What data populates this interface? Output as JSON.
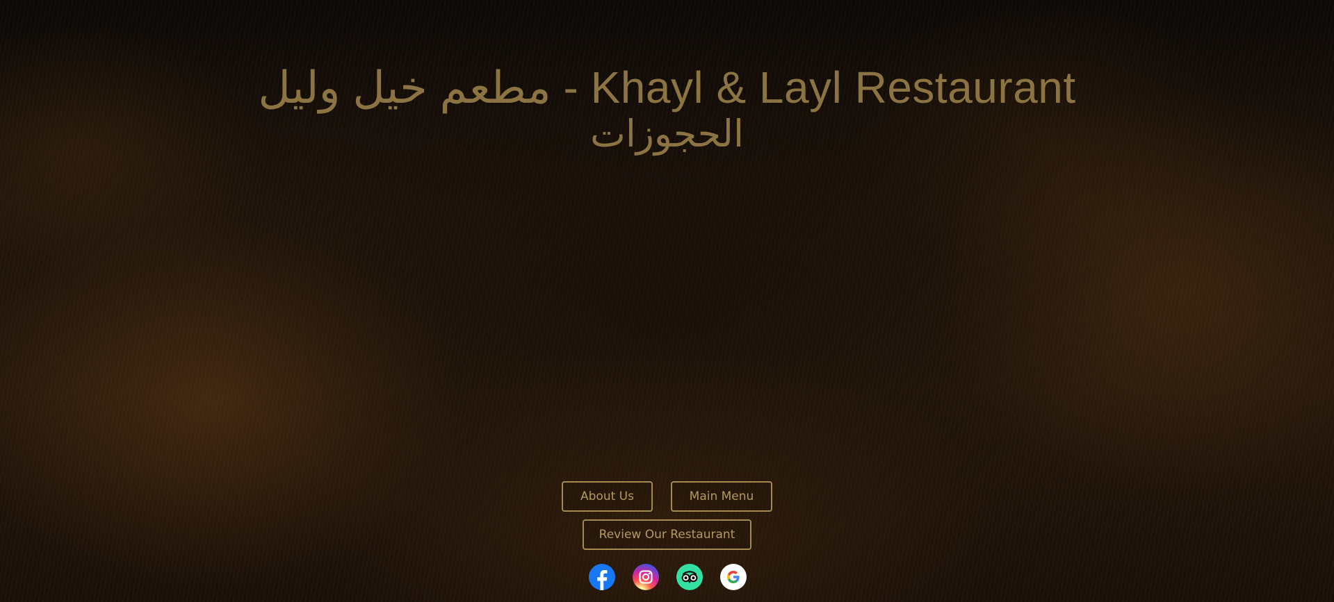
{
  "header": {
    "title": "مطعم خيل وليل - Khayl & Layl Restaurant",
    "subtitle": "الحجوزات"
  },
  "nav": {
    "about_label": "About Us",
    "menu_label": "Main Menu",
    "review_label": "Review Our Restaurant"
  },
  "social": [
    {
      "icon": "facebook-icon",
      "color": "#1877f2"
    },
    {
      "icon": "instagram-icon",
      "color": "#d6249f"
    },
    {
      "icon": "tripadvisor-icon",
      "color": "#34e0a1"
    },
    {
      "icon": "google-icon",
      "color": "#ffffff"
    }
  ],
  "colors": {
    "accent_gold": "#a58a4f",
    "title_gold": "#8c7442",
    "background": "#1f140b"
  }
}
